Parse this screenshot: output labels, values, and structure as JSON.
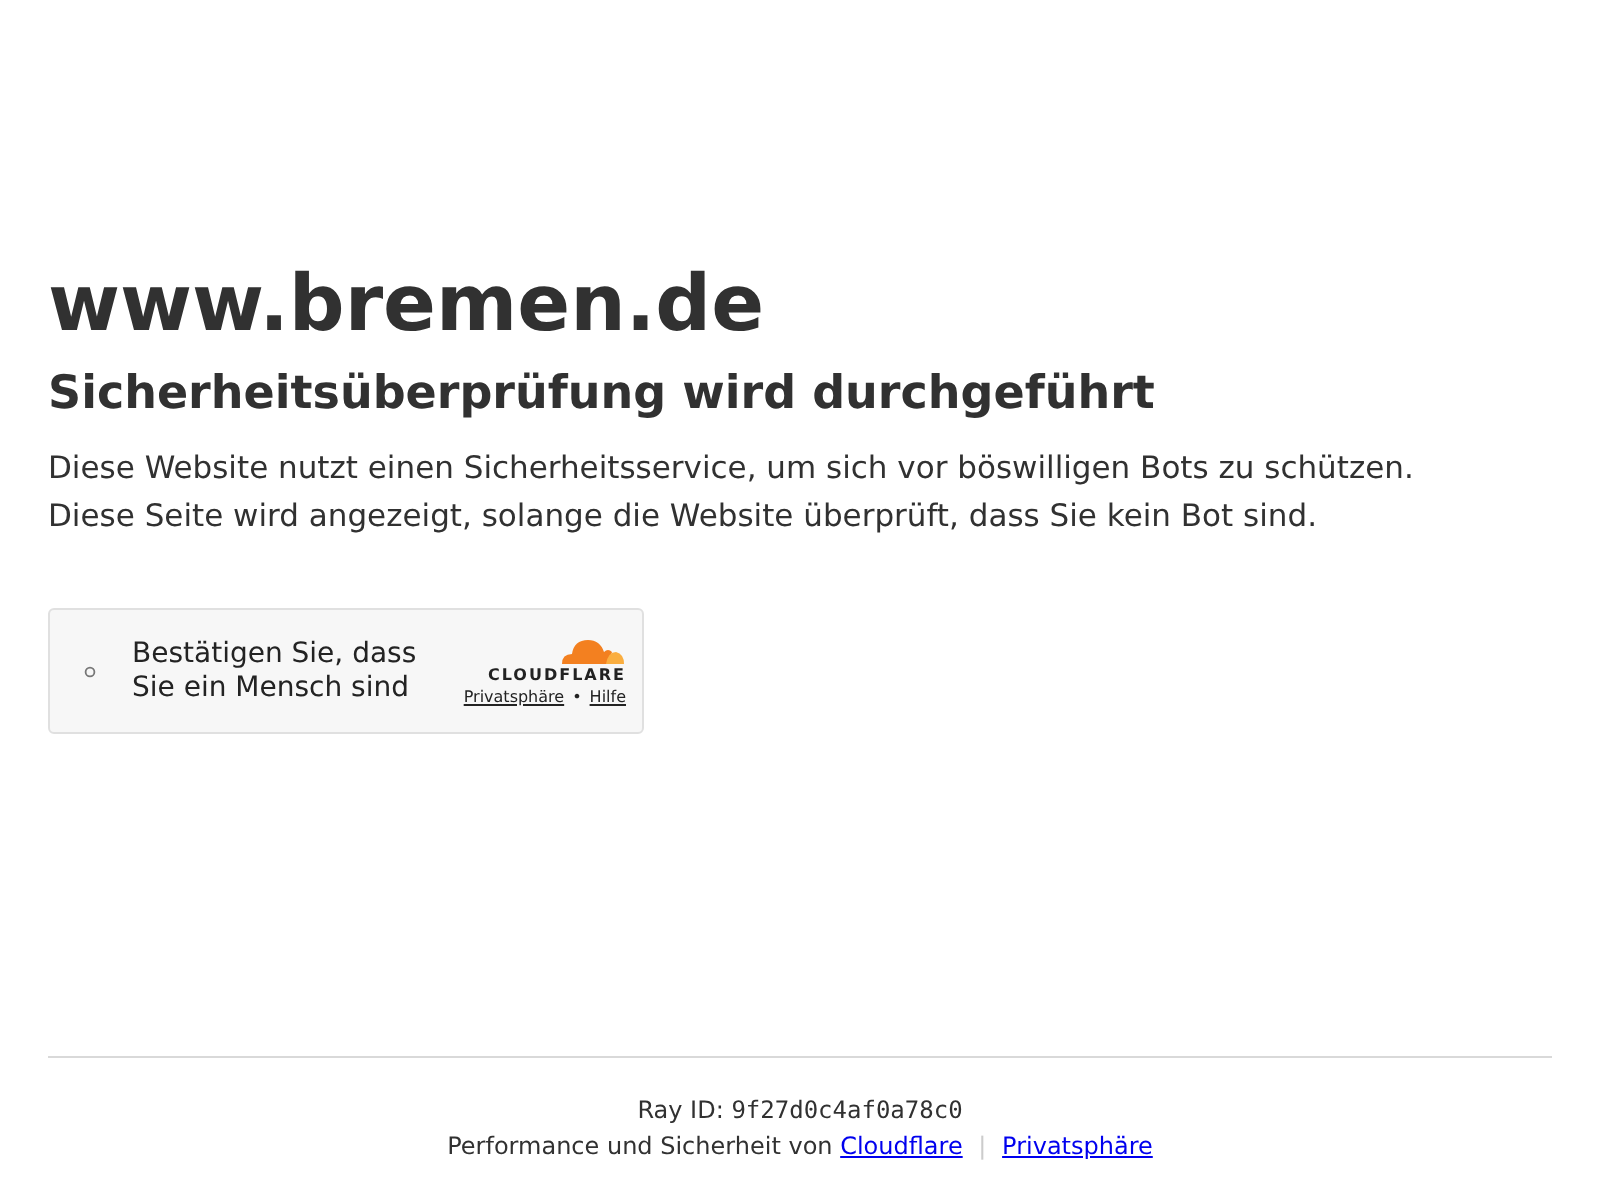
{
  "site_title": "www.bremen.de",
  "heading": "Sicherheitsüberprüfung wird durchgeführt",
  "paragraphs": [
    "Diese Website nutzt einen Sicherheitsservice, um sich vor böswilligen Bots zu schützen.",
    "Diese Seite wird angezeigt, solange die Website überprüft, dass Sie kein Bot sind."
  ],
  "widget": {
    "label": "Bestätigen Sie, dass Sie ein Mensch sind",
    "brand": "CLOUDFLARE",
    "links": [
      "Privatsphäre",
      "Hilfe"
    ],
    "link_separator": "•"
  },
  "footer": {
    "ray_label": "Ray ID:",
    "ray_id": "9f27d0c4af0a78c0",
    "credit": "Performance und Sicherheit von",
    "links": [
      "Cloudflare",
      "Privatsphäre"
    ],
    "separator": "|"
  }
}
